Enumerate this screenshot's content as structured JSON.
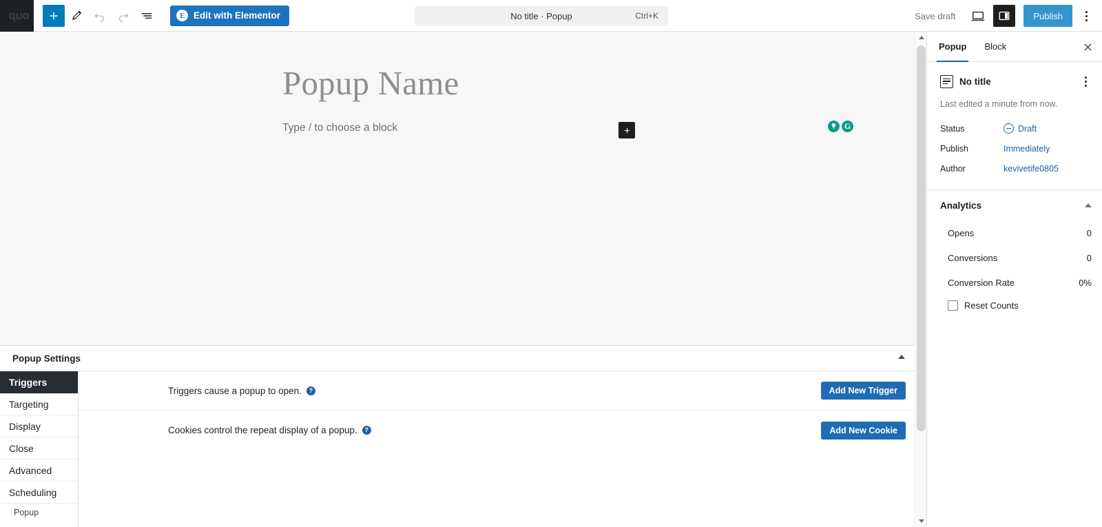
{
  "topbar": {
    "logo_text": "oup",
    "add_block_label": "+",
    "tools_icon": "pencil-icon",
    "undo_icon": "undo-icon",
    "redo_icon": "redo-icon",
    "listview_icon": "list-view-icon",
    "elementor_badge": "E",
    "elementor_label": "Edit with Elementor",
    "command_title": "No title · Popup",
    "command_shortcut": "Ctrl+K",
    "save_draft_label": "Save draft",
    "preview_icon": "desktop-preview-icon",
    "settings_icon": "sidebar-toggle-icon",
    "publish_label": "Publish",
    "more_icon": "more-options-icon",
    "accent_blue": "#007cba",
    "elementor_blue": "#1e73be",
    "publish_blue": "#3495cc"
  },
  "canvas": {
    "title_placeholder": "Popup Name",
    "block_placeholder": "Type / to choose a block",
    "inserter_label": "+",
    "grammarly": {
      "bulb_icon": "lightbulb-icon",
      "logo_letter": "G",
      "color": "#0b9b84"
    }
  },
  "settings": {
    "panel_title": "Popup Settings",
    "foot_label": "Popup",
    "tabs": [
      {
        "label": "Triggers",
        "active": true
      },
      {
        "label": "Targeting",
        "active": false
      },
      {
        "label": "Display",
        "active": false
      },
      {
        "label": "Close",
        "active": false
      },
      {
        "label": "Advanced",
        "active": false
      },
      {
        "label": "Scheduling",
        "active": false
      }
    ],
    "rows": [
      {
        "text": "Triggers cause a popup to open.",
        "help": "?",
        "button": "Add New Trigger"
      },
      {
        "text": "Cookies control the repeat display of a popup.",
        "help": "?",
        "button": "Add New Cookie"
      }
    ],
    "button_color": "#1e6cb3"
  },
  "sidebar": {
    "tabs": [
      {
        "label": "Popup",
        "active": true
      },
      {
        "label": "Block",
        "active": false
      }
    ],
    "close_icon": "close-icon",
    "document": {
      "icon": "document-icon",
      "title": "No title",
      "more_icon": "more-options-icon",
      "last_edited": "Last edited a minute from now."
    },
    "meta": [
      {
        "label": "Status",
        "value": "Draft",
        "icon": "draft-status-icon"
      },
      {
        "label": "Publish",
        "value": "Immediately",
        "icon": ""
      },
      {
        "label": "Author",
        "value": "kevivetife0805",
        "icon": ""
      }
    ],
    "analytics": {
      "title": "Analytics",
      "collapse_icon": "chevron-up-icon",
      "stats": [
        {
          "label": "Opens",
          "value": "0"
        },
        {
          "label": "Conversions",
          "value": "0"
        },
        {
          "label": "Conversion Rate",
          "value": "0%"
        }
      ],
      "reset_label": "Reset Counts",
      "reset_checked": false
    },
    "link_color": "#1e62a8"
  }
}
